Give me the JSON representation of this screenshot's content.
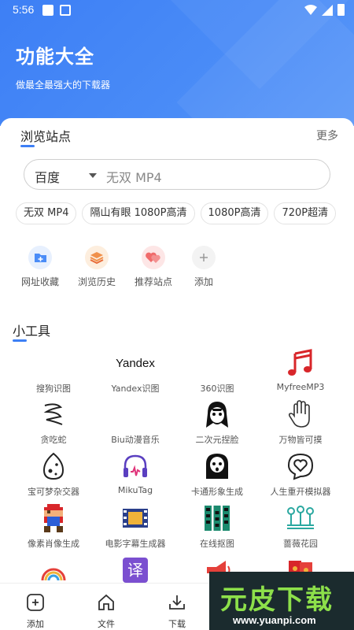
{
  "status": {
    "time": "5:56"
  },
  "header": {
    "title": "功能大全",
    "subtitle": "做最全最强大的下载器"
  },
  "browse": {
    "heading": "浏览站点",
    "more": "更多",
    "search": {
      "engine": "百度",
      "placeholder": "无双 MP4"
    },
    "chips": [
      "无双 MP4",
      "隔山有眼 1080P高清",
      "1080P高清",
      "720P超清"
    ]
  },
  "quick": [
    {
      "label": "网址收藏",
      "icon": "folder-plus-icon",
      "color": "#4a8cf7"
    },
    {
      "label": "浏览历史",
      "icon": "layers-icon",
      "color": "#f0904a"
    },
    {
      "label": "推荐站点",
      "icon": "hearts-icon",
      "color": "#f06b6b"
    },
    {
      "label": "添加",
      "icon": "plus-icon",
      "color": "#999999"
    }
  ],
  "tools": {
    "heading": "小工具",
    "items": [
      {
        "label": "搜狗识图",
        "icon": "sogou-icon"
      },
      {
        "label": "Yandex识图",
        "icon": "yandex-logo",
        "logo_text": "Yandex"
      },
      {
        "label": "360识图",
        "icon": "360-icon"
      },
      {
        "label": "MyfreeMP3",
        "icon": "music-note-icon"
      },
      {
        "label": "贪吃蛇",
        "icon": "snake-icon"
      },
      {
        "label": "Biu动漫音乐",
        "icon": "anime-music-icon"
      },
      {
        "label": "二次元捏脸",
        "icon": "anime-face-icon"
      },
      {
        "label": "万物皆可摸",
        "icon": "hand-icon"
      },
      {
        "label": "宝可梦杂交器",
        "icon": "egg-icon"
      },
      {
        "label": "MikuTag",
        "icon": "headphones-icon"
      },
      {
        "label": "卡通形象生成",
        "icon": "ghost-icon"
      },
      {
        "label": "人生重开模拟器",
        "icon": "heart-bubble-icon"
      },
      {
        "label": "像素肖像生成",
        "icon": "pixel-mario-icon"
      },
      {
        "label": "电影字幕生成器",
        "icon": "film-icon"
      },
      {
        "label": "在线抠图",
        "icon": "filmstrip-icon"
      },
      {
        "label": "蔷薇花园",
        "icon": "garden-icon"
      },
      {
        "label": "",
        "icon": "rainbow-icon"
      },
      {
        "label": "",
        "icon": "translate-icon",
        "logo_text": "译"
      },
      {
        "label": "",
        "icon": "megaphone-icon"
      },
      {
        "label": "",
        "icon": "red-envelope-icon"
      }
    ]
  },
  "bottom_nav": [
    {
      "label": "添加",
      "icon": "add-box-icon"
    },
    {
      "label": "文件",
      "icon": "home-icon"
    },
    {
      "label": "下载",
      "icon": "download-icon"
    }
  ],
  "watermark": {
    "brand": "元皮下载",
    "url": "www.yuanpi.com"
  }
}
